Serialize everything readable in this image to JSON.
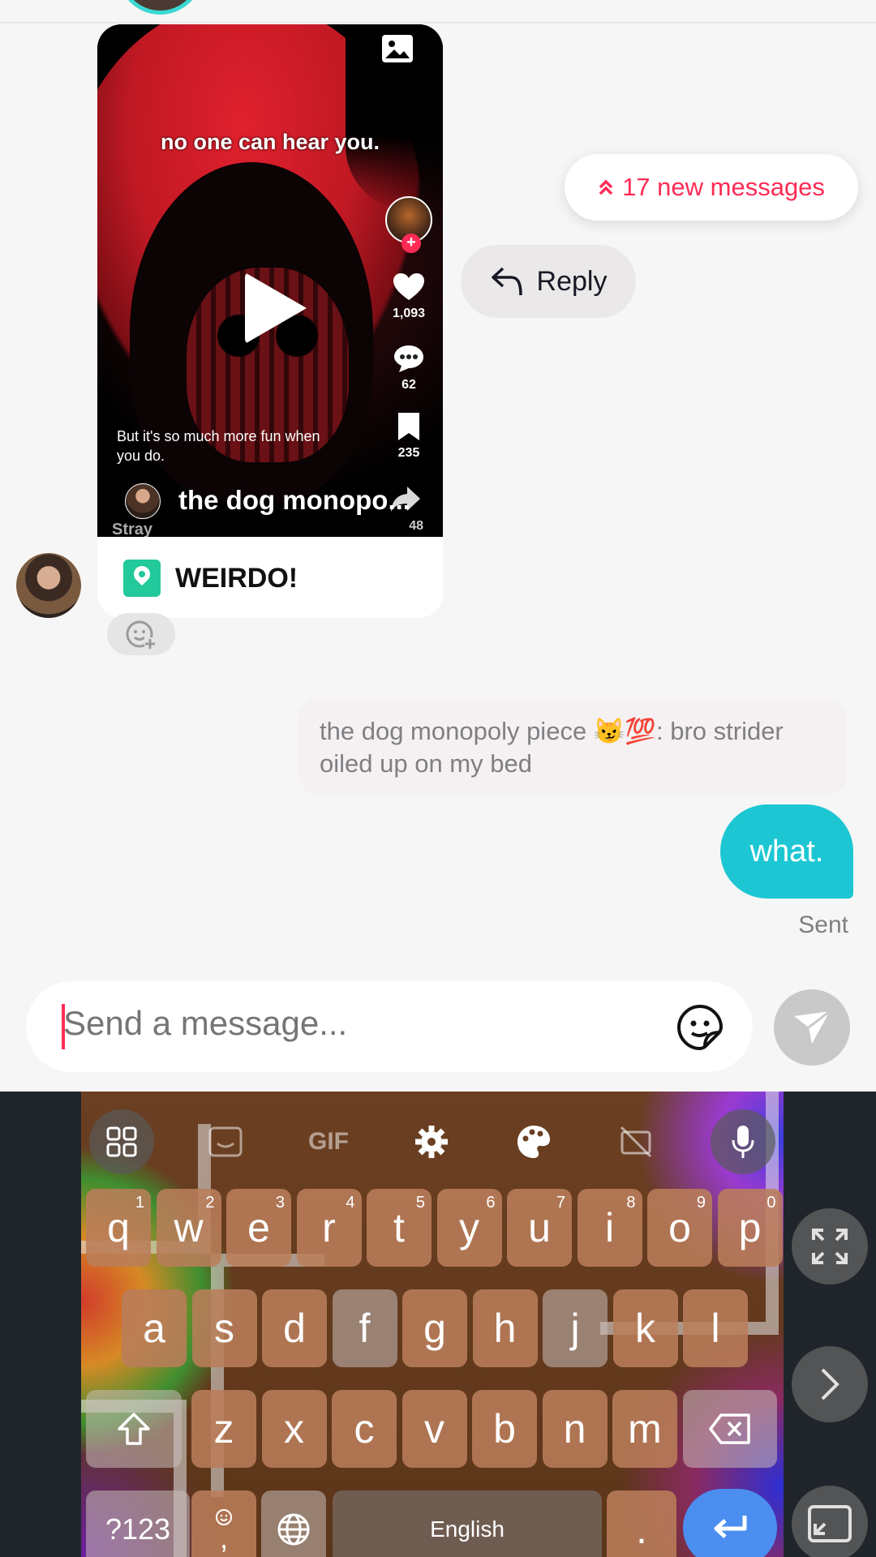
{
  "video": {
    "caption": "no one can hear you.",
    "likes": "1,093",
    "comments": "62",
    "saves": "235",
    "shares": "48",
    "description": "But it's so much more fun when you do.",
    "music_title": "the dog monopo...",
    "sound_tag": "Stray"
  },
  "shared_post": {
    "location_label": "WEIRDO!"
  },
  "actions": {
    "new_messages": "17 new messages",
    "reply": "Reply"
  },
  "messages": [
    {
      "type": "quote",
      "text": "the dog monopoly piece 😼💯: bro strider oiled up on my bed"
    },
    {
      "type": "sent",
      "text": "what.",
      "status": "Sent"
    }
  ],
  "composer": {
    "placeholder": "Send a message..."
  },
  "keyboard": {
    "toolbar": {
      "gif": "GIF"
    },
    "row1": [
      {
        "k": "q",
        "n": "1"
      },
      {
        "k": "w",
        "n": "2"
      },
      {
        "k": "e",
        "n": "3"
      },
      {
        "k": "r",
        "n": "4"
      },
      {
        "k": "t",
        "n": "5"
      },
      {
        "k": "y",
        "n": "6"
      },
      {
        "k": "u",
        "n": "7"
      },
      {
        "k": "i",
        "n": "8"
      },
      {
        "k": "o",
        "n": "9"
      },
      {
        "k": "p",
        "n": "0"
      }
    ],
    "row2": [
      "a",
      "s",
      "d",
      "f",
      "g",
      "h",
      "j",
      "k",
      "l"
    ],
    "row3": [
      "z",
      "x",
      "c",
      "v",
      "b",
      "n",
      "m"
    ],
    "symbols": "?123",
    "comma": ",",
    "space": "English",
    "period": "."
  },
  "colors": {
    "accent_pink": "#fe2c55",
    "sent_bubble": "#1cc7d3",
    "enter_key": "#4c8ef0"
  }
}
